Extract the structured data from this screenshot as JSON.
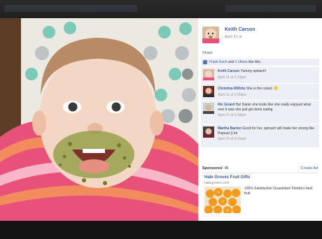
{
  "post": {
    "poster_name": "Keith Carson",
    "poster_date": "April 21 at",
    "share_label": "Share"
  },
  "likes": {
    "name": "Frank Koch",
    "and": "and",
    "others": "2 others",
    "suffix": "like this."
  },
  "comments": [
    {
      "name": "Keith Carson",
      "text": "Yummy spinach!",
      "date": "April 21 at 2:13pm"
    },
    {
      "name": "Christina Wilhite",
      "text": "She is the cutest",
      "date": "April 21 at 2:30pm"
    },
    {
      "name": "Ric Girard",
      "text": "Ha! Damn she looks like she really enjoyed what ever it was she just got done eating",
      "date": "April 21 at 5:18pm"
    },
    {
      "name": "Martha Barton",
      "text": "Good for her, spinach will make her strong like Popeye:)) lol",
      "date": "April 22 at 8:15am"
    }
  ],
  "sponsored": {
    "label": "Sponsored",
    "create_ad": "Create Ad",
    "ad_title": "Hale Groves Fruit Gifts",
    "ad_domain": "halegroves.com",
    "ad_text": "100% Satisfaction Guarantee! Florida's best fruit"
  },
  "colors": {
    "link_blue": "#3b5998",
    "comment_bg": "#eceff5",
    "viewer_bg": "#1a1a1a"
  },
  "icons": {
    "like": "thumb-up-icon",
    "emoticon": "smile-icon",
    "sponsored_info": "info-icon"
  }
}
